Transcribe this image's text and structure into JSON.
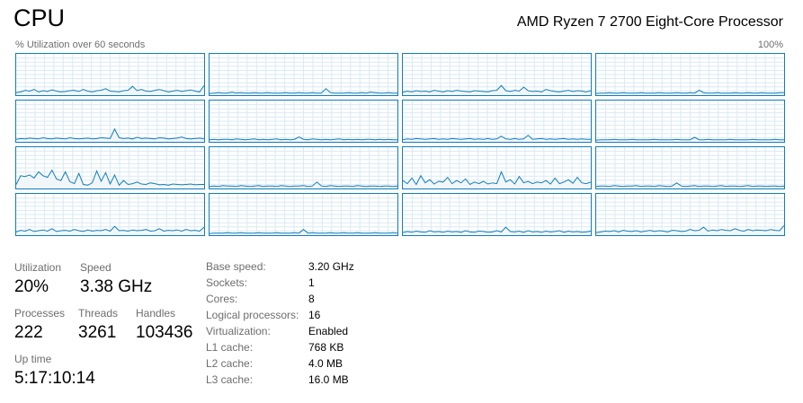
{
  "header": {
    "title": "CPU",
    "processor": "AMD Ryzen 7 2700 Eight-Core Processor",
    "graph_caption": "% Utilization over 60 seconds",
    "graph_max": "100%"
  },
  "colors": {
    "graph_line": "#117dbb",
    "graph_fill": "#f1f6fa",
    "graph_grid": "#d9eaf4",
    "label": "#6d6d6d"
  },
  "stats": {
    "utilization": {
      "label": "Utilization",
      "value": "20%"
    },
    "speed": {
      "label": "Speed",
      "value": "3.38 GHz"
    },
    "processes": {
      "label": "Processes",
      "value": "222"
    },
    "threads": {
      "label": "Threads",
      "value": "3261"
    },
    "handles": {
      "label": "Handles",
      "value": "103436"
    },
    "uptime": {
      "label": "Up time",
      "value": "5:17:10:14"
    }
  },
  "details": [
    {
      "key": "Base speed:",
      "value": "3.20 GHz"
    },
    {
      "key": "Sockets:",
      "value": "1"
    },
    {
      "key": "Cores:",
      "value": "8"
    },
    {
      "key": "Logical processors:",
      "value": "16"
    },
    {
      "key": "Virtualization:",
      "value": "Enabled"
    },
    {
      "key": "L1 cache:",
      "value": "768 KB"
    },
    {
      "key": "L2 cache:",
      "value": "4.0 MB"
    },
    {
      "key": "L3 cache:",
      "value": "16.0 MB"
    }
  ],
  "cores": [
    [
      4,
      6,
      10,
      8,
      12,
      6,
      9,
      7,
      11,
      8,
      6,
      7,
      9,
      10,
      7,
      12,
      8,
      6,
      9,
      10,
      14,
      8,
      7,
      6,
      9,
      10,
      20,
      9,
      12,
      8,
      7,
      10,
      12,
      9,
      6,
      8,
      10,
      7,
      9,
      11,
      8,
      6,
      22
    ],
    [
      2,
      3,
      4,
      3,
      3,
      5,
      3,
      4,
      3,
      3,
      4,
      3,
      3,
      4,
      3,
      3,
      3,
      4,
      3,
      3,
      4,
      3,
      3,
      4,
      3,
      3,
      14,
      4,
      3,
      3,
      3,
      4,
      3,
      3,
      4,
      3,
      5,
      4,
      3,
      3,
      4,
      3,
      3
    ],
    [
      5,
      8,
      6,
      9,
      7,
      8,
      6,
      10,
      8,
      6,
      9,
      7,
      10,
      8,
      7,
      6,
      9,
      8,
      7,
      6,
      9,
      10,
      22,
      9,
      7,
      10,
      8,
      18,
      9,
      7,
      8,
      6,
      12,
      9,
      7,
      6,
      8,
      10,
      7,
      9,
      8,
      6,
      9
    ],
    [
      2,
      3,
      3,
      4,
      3,
      3,
      4,
      3,
      3,
      3,
      4,
      3,
      3,
      3,
      4,
      3,
      3,
      3,
      4,
      3,
      3,
      4,
      3,
      10,
      4,
      3,
      3,
      4,
      3,
      3,
      3,
      4,
      3,
      3,
      4,
      3,
      3,
      4,
      3,
      3,
      3,
      4,
      4
    ],
    [
      4,
      6,
      5,
      7,
      6,
      5,
      8,
      6,
      5,
      7,
      6,
      5,
      8,
      6,
      5,
      6,
      7,
      5,
      6,
      8,
      7,
      6,
      30,
      8,
      6,
      7,
      5,
      9,
      6,
      7,
      6,
      5,
      8,
      7,
      5,
      6,
      7,
      10,
      6,
      5,
      6,
      7,
      5
    ],
    [
      3,
      4,
      3,
      4,
      4,
      3,
      5,
      4,
      3,
      4,
      5,
      3,
      4,
      3,
      4,
      5,
      3,
      4,
      3,
      4,
      10,
      4,
      3,
      5,
      4,
      3,
      4,
      3,
      4,
      5,
      3,
      4,
      3,
      4,
      3,
      4,
      4,
      3,
      4,
      3,
      4,
      3,
      3
    ],
    [
      3,
      5,
      4,
      6,
      5,
      4,
      5,
      6,
      4,
      5,
      4,
      6,
      5,
      4,
      5,
      6,
      4,
      5,
      4,
      6,
      4,
      5,
      12,
      5,
      4,
      6,
      4,
      5,
      14,
      4,
      5,
      6,
      4,
      5,
      4,
      5,
      6,
      4,
      5,
      4,
      5,
      4,
      4
    ],
    [
      2,
      3,
      3,
      3,
      4,
      3,
      3,
      3,
      4,
      3,
      3,
      3,
      3,
      4,
      3,
      3,
      3,
      3,
      4,
      3,
      3,
      3,
      9,
      3,
      3,
      4,
      3,
      3,
      3,
      3,
      4,
      3,
      3,
      3,
      3,
      4,
      3,
      3,
      3,
      3,
      4,
      3,
      3
    ],
    [
      8,
      30,
      28,
      32,
      24,
      40,
      30,
      26,
      44,
      22,
      18,
      40,
      15,
      10,
      36,
      8,
      6,
      12,
      42,
      16,
      38,
      9,
      32,
      6,
      18,
      8,
      10,
      14,
      9,
      8,
      12,
      10,
      7,
      8,
      6,
      9,
      8,
      7,
      8,
      9,
      7,
      8,
      8
    ],
    [
      3,
      4,
      3,
      5,
      4,
      4,
      3,
      5,
      4,
      3,
      4,
      5,
      3,
      4,
      4,
      3,
      5,
      4,
      3,
      4,
      4,
      5,
      3,
      4,
      14,
      4,
      3,
      5,
      4,
      3,
      4,
      4,
      3,
      5,
      4,
      3,
      4,
      4,
      3,
      4,
      4,
      3,
      4
    ],
    [
      18,
      10,
      24,
      8,
      30,
      12,
      20,
      9,
      16,
      14,
      26,
      10,
      18,
      12,
      22,
      8,
      14,
      10,
      16,
      9,
      12,
      10,
      40,
      14,
      20,
      9,
      28,
      12,
      16,
      10,
      14,
      12,
      18,
      9,
      24,
      10,
      14,
      20,
      11,
      26,
      12,
      10,
      14
    ],
    [
      3,
      4,
      4,
      3,
      5,
      4,
      3,
      4,
      4,
      5,
      3,
      4,
      4,
      3,
      5,
      4,
      3,
      4,
      12,
      4,
      3,
      4,
      5,
      3,
      4,
      4,
      3,
      4,
      5,
      3,
      4,
      4,
      3,
      4,
      5,
      3,
      4,
      4,
      3,
      4,
      4,
      3,
      4
    ],
    [
      6,
      10,
      8,
      12,
      7,
      9,
      11,
      8,
      14,
      7,
      9,
      10,
      8,
      12,
      9,
      7,
      11,
      8,
      10,
      9,
      12,
      8,
      20,
      9,
      10,
      8,
      11,
      9,
      10,
      12,
      8,
      9,
      14,
      8,
      10,
      9,
      11,
      8,
      12,
      9,
      10,
      8,
      18
    ],
    [
      2,
      3,
      3,
      3,
      4,
      3,
      3,
      4,
      3,
      3,
      3,
      4,
      3,
      3,
      3,
      4,
      3,
      3,
      3,
      4,
      3,
      12,
      3,
      4,
      3,
      3,
      3,
      4,
      3,
      3,
      4,
      3,
      3,
      4,
      3,
      3,
      3,
      4,
      3,
      3,
      3,
      4,
      3
    ],
    [
      4,
      7,
      5,
      8,
      6,
      5,
      9,
      6,
      7,
      5,
      8,
      6,
      7,
      5,
      9,
      6,
      5,
      8,
      7,
      5,
      6,
      9,
      6,
      18,
      7,
      6,
      8,
      5,
      9,
      6,
      7,
      5,
      8,
      6,
      7,
      9,
      5,
      8,
      6,
      7,
      5,
      6,
      8
    ],
    [
      4,
      6,
      8,
      7,
      9,
      6,
      10,
      8,
      7,
      9,
      6,
      8,
      10,
      7,
      9,
      8,
      6,
      10,
      9,
      7,
      8,
      12,
      9,
      10,
      18,
      8,
      11,
      9,
      12,
      10,
      9,
      14,
      10,
      8,
      12,
      9,
      11,
      10,
      9,
      12,
      10,
      9,
      22
    ]
  ]
}
